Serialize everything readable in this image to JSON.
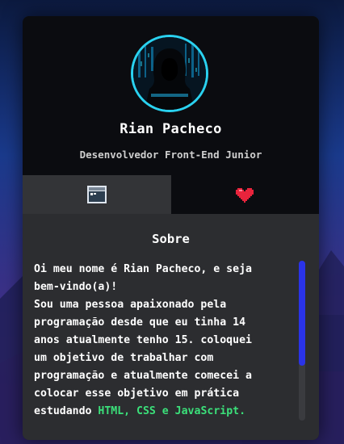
{
  "profile": {
    "name": "Rian Pacheco",
    "role": "Desenvolvedor Front-End Junior",
    "avatar_ring_color": "#2ad2f0"
  },
  "tabs": [
    {
      "icon": "browser-window-icon",
      "active": true
    },
    {
      "icon": "heart-icon",
      "active": false
    }
  ],
  "about": {
    "title": "Sobre",
    "line1": "Oi meu nome é Rian Pacheco, e seja",
    "line2": "bem-vindo(a)!",
    "line3": "Sou uma pessoa apaixonado pela",
    "line4": "programação desde que eu tinha 14",
    "line5": "anos atualmente tenho 15. coloquei",
    "line6": "um objetivo de trabalhar com",
    "line7": "programação e atualmente comecei a",
    "line8": "colocar esse objetivo em prática",
    "line9_prefix": "estudando ",
    "tech": "HTML, CSS e JavaScript."
  },
  "colors": {
    "accent_green": "#3be07a",
    "scroll_thumb": "#2a33e8",
    "heart": "#e8243c"
  }
}
